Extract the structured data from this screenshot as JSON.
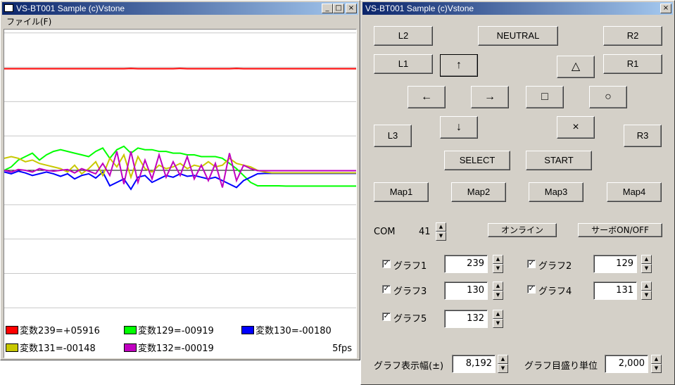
{
  "left_window": {
    "title": "VS-BT001 Sample (c)Vstone",
    "caption_buttons": [
      "_",
      "□",
      "×"
    ],
    "menu": [
      "ファイル(F)"
    ],
    "fps": "5fps",
    "legend": [
      {
        "text": "変数239=+05916",
        "color": "#ff0000"
      },
      {
        "text": "変数129=-00919",
        "color": "#00ff00"
      },
      {
        "text": "変数130=-00180",
        "color": "#0000ff"
      },
      {
        "text": "変数131=-00148",
        "color": "#c8c800"
      },
      {
        "text": "変数132=-00019",
        "color": "#c000c0"
      }
    ]
  },
  "right_window": {
    "title": "VS-BT001 Sample (c)Vstone",
    "close": "×",
    "buttons": {
      "l2": "L2",
      "neutral": "NEUTRAL",
      "r2": "R2",
      "l1": "L1",
      "up": "↑",
      "triangle": "△",
      "r1": "R1",
      "left": "←",
      "right": "→",
      "square": "□",
      "circle": "○",
      "l3": "L3",
      "down": "↓",
      "cross": "×",
      "r3": "R3",
      "select": "SELECT",
      "start": "START",
      "map1": "Map1",
      "map2": "Map2",
      "map3": "Map3",
      "map4": "Map4",
      "online": "オンライン",
      "servo": "サーボON/OFF"
    },
    "com": {
      "label": "COM",
      "value": "41"
    },
    "graphs": [
      {
        "label": "グラフ1",
        "checked": true,
        "value": "239"
      },
      {
        "label": "グラフ2",
        "checked": true,
        "value": "129"
      },
      {
        "label": "グラフ3",
        "checked": true,
        "value": "130"
      },
      {
        "label": "グラフ4",
        "checked": true,
        "value": "131"
      },
      {
        "label": "グラフ5",
        "checked": true,
        "value": "132"
      }
    ],
    "width": {
      "label": "グラフ表示幅(±)",
      "value": "8,192"
    },
    "scale": {
      "label": "グラフ目盛り単位",
      "value": "2,000"
    }
  },
  "chart_data": {
    "type": "line",
    "title": "",
    "ylim": [
      -8192,
      8192
    ],
    "grid_step": 2000,
    "x": [
      0,
      10,
      20,
      30,
      40,
      50,
      60,
      70,
      80,
      90,
      100,
      110,
      120,
      130,
      140,
      150,
      160,
      170,
      180,
      190,
      200,
      210,
      220,
      230,
      240,
      250,
      260,
      270,
      280,
      290,
      300,
      310,
      320,
      330,
      340,
      350,
      360,
      370,
      380,
      390,
      400,
      410,
      420,
      430,
      440,
      450,
      460,
      470,
      480,
      490,
      500
    ],
    "series": [
      {
        "name": "変数239",
        "color": "#ff0000",
        "values": [
          5916,
          5916,
          5916,
          5916,
          5916,
          5916,
          5916,
          5916,
          5916,
          5916,
          5916,
          5916,
          5916,
          5916,
          5916,
          5916,
          5916,
          5916,
          5930,
          5916,
          5916,
          5916,
          5916,
          5916,
          5916,
          5930,
          5916,
          5916,
          5916,
          5916,
          5916,
          5916,
          5916,
          5930,
          5916,
          5916,
          5916,
          5916,
          5916,
          5916,
          5916,
          5916,
          5916,
          5916,
          5916,
          5916,
          5916,
          5916,
          5916,
          5916,
          5916
        ]
      },
      {
        "name": "変数129",
        "color": "#00ff00",
        "values": [
          0,
          200,
          600,
          800,
          1000,
          600,
          900,
          1100,
          1200,
          1100,
          1000,
          900,
          800,
          1100,
          1300,
          700,
          1200,
          1400,
          1000,
          1300,
          1200,
          1200,
          1100,
          1100,
          1000,
          1000,
          900,
          900,
          800,
          800,
          800,
          700,
          400,
          100,
          -300,
          -700,
          -900,
          -900,
          -900,
          -900,
          -919,
          -919,
          -919,
          -919,
          -919,
          -919,
          -919,
          -919,
          -919,
          -919,
          -919
        ]
      },
      {
        "name": "変数130",
        "color": "#0000ff",
        "values": [
          -100,
          -200,
          -50,
          -150,
          -300,
          -200,
          -100,
          -200,
          -350,
          -200,
          -500,
          -300,
          -200,
          -450,
          -100,
          -900,
          -700,
          -500,
          -1100,
          -400,
          -300,
          -700,
          -500,
          -300,
          -400,
          -200,
          -350,
          -300,
          -400,
          -500,
          -400,
          -600,
          -800,
          -1000,
          -600,
          -400,
          -200,
          -180,
          -180,
          -180,
          -180,
          -180,
          -180,
          -180,
          -180,
          -180,
          -180,
          -180,
          -180,
          -180,
          -180
        ]
      },
      {
        "name": "変数131",
        "color": "#c8c800",
        "values": [
          700,
          800,
          700,
          500,
          600,
          400,
          300,
          200,
          100,
          -100,
          300,
          -200,
          100,
          500,
          -300,
          700,
          200,
          900,
          -400,
          800,
          100,
          -100,
          300,
          100,
          200,
          400,
          100,
          300,
          200,
          500,
          200,
          300,
          700,
          400,
          300,
          200,
          0,
          -100,
          -148,
          -148,
          -148,
          -148,
          -148,
          -148,
          -148,
          -148,
          -148,
          -148,
          -148,
          -148,
          -148
        ]
      },
      {
        "name": "変数132",
        "color": "#c000c0",
        "values": [
          0,
          -100,
          50,
          0,
          -100,
          100,
          0,
          -50,
          0,
          50,
          -150,
          100,
          -50,
          -200,
          400,
          -300,
          1100,
          -800,
          1100,
          -700,
          600,
          -500,
          900,
          -400,
          500,
          -300,
          800,
          -500,
          300,
          -600,
          400,
          -1000,
          1000,
          -600,
          300,
          100,
          -19,
          -19,
          -19,
          -19,
          -19,
          -19,
          -19,
          -19,
          -19,
          -19,
          -19,
          -19,
          -19,
          -19,
          -19
        ]
      }
    ]
  }
}
